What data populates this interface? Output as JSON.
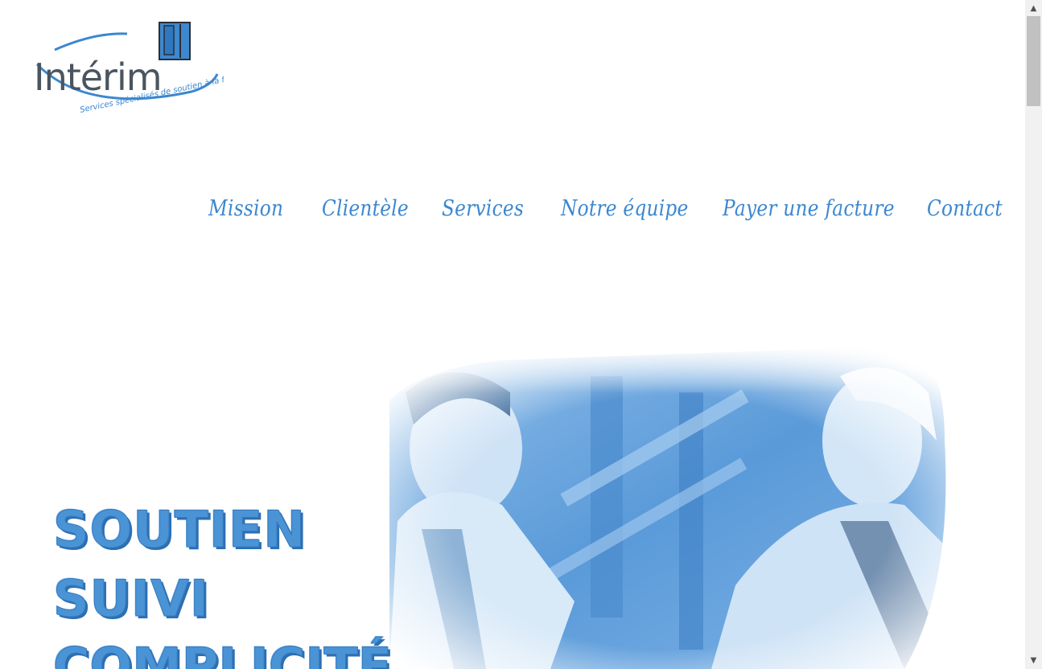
{
  "logo": {
    "wordmark": "Intérim",
    "tagline": "Services spécialisés de soutien à la famille"
  },
  "nav": {
    "items": [
      {
        "label": "Mission"
      },
      {
        "label": "Clientèle"
      },
      {
        "label": "Services"
      },
      {
        "label": "Notre équipe"
      },
      {
        "label": "Payer une facture"
      },
      {
        "label": "Contact"
      }
    ]
  },
  "hero": {
    "lines": [
      "SOUTIEN",
      "SUIVI",
      "COMPLICITÉ"
    ]
  },
  "colors": {
    "brand_blue": "#3b87d0",
    "headline_blue": "#4a94d6",
    "logo_gray": "#4a5560"
  },
  "scrollbar": {
    "up_icon": "arrow-up-icon",
    "down_icon": "arrow-down-icon"
  }
}
